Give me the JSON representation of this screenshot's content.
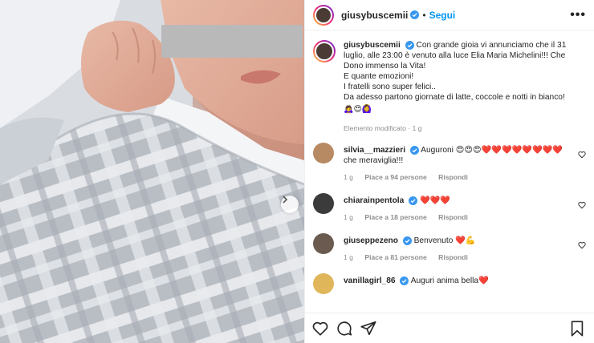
{
  "post": {
    "author": "giusybuscemii",
    "follow_label": "Segui",
    "separator": "•",
    "more_label": "•••"
  },
  "caption": {
    "author": "giusybuscemii",
    "lines": [
      "Con grande gioia vi annunciamo che il 31 luglio, alle 23:00 è venuto alla luce Elia Maria Michelini!!! Che Dono immenso la Vita!",
      "E quante emozioni!",
      "I fratelli sono super felici..",
      "Da adesso partono giornate di latte, coccole e notti in bianco!"
    ],
    "emojis": "🙇‍♀️😍🙆‍♀️",
    "meta": "Elemento modificato · 1 g"
  },
  "comments": [
    {
      "user": "silvia__mazzieri",
      "text": "Auguroni 😍😍😍❤️❤️❤️❤️❤️❤️❤️❤️ che meraviglia!!!",
      "time": "1 g",
      "likes": "Piace a 94 persone",
      "reply": "Rispondi",
      "avatar_color": "#b88a63"
    },
    {
      "user": "chiarainpentola",
      "text": "❤️❤️❤️",
      "time": "1 g",
      "likes": "Piace a 18 persone",
      "reply": "Rispondi",
      "avatar_color": "#3b3b3b"
    },
    {
      "user": "giuseppezeno",
      "text": "Benvenuto ❤️💪",
      "time": "1 g",
      "likes": "Piace a 81 persone",
      "reply": "Rispondi",
      "avatar_color": "#6a5a50"
    },
    {
      "user": "vanillagirl_86",
      "text": "Auguri anima bella❤️",
      "time": "",
      "likes": "",
      "reply": "",
      "avatar_color": "#e0b65a"
    }
  ],
  "icons": [
    "heart-icon",
    "comment-icon",
    "share-icon",
    "bookmark-icon",
    "verified-icon",
    "chevron-right-icon",
    "more-icon"
  ],
  "colors": {
    "accent": "#0095f6",
    "verified": "#3897f0",
    "meta": "#8e8e8e",
    "border": "#efefef"
  }
}
